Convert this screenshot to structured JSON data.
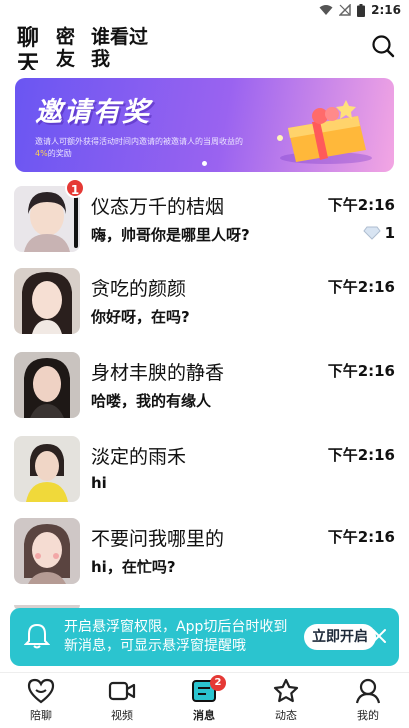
{
  "status_bar": {
    "time": "2:16",
    "icons": [
      "wifi-icon",
      "signal-off-icon",
      "battery-icon"
    ]
  },
  "header": {
    "tabs": [
      "聊天",
      "密友",
      "谁看过我"
    ],
    "search_icon": "search-icon"
  },
  "banner": {
    "title": "邀请有奖",
    "desc_part1": "邀请人可额外获得活动时间内邀请的被邀请人的当周收益的",
    "desc_highlight": "4%",
    "desc_part2": "的奖励",
    "highlight_color": "#ffd34d"
  },
  "conversations": [
    {
      "name": "仪态万千的桔烟",
      "message": "嗨，帅哥你是哪里人呀?",
      "time": "下午2:16",
      "unread": "1",
      "extra": "1",
      "extra_icon": "diamond-icon"
    },
    {
      "name": "贪吃的颜颜",
      "message": "你好呀，在吗?",
      "time": "下午2:16"
    },
    {
      "name": "身材丰腴的静香",
      "message": "哈喽，我的有缘人",
      "time": "下午2:16"
    },
    {
      "name": "淡定的雨禾",
      "message": "hi",
      "time": "下午2:16"
    },
    {
      "name": "不要问我哪里的",
      "message": "hi，在忙吗?",
      "time": "下午2:16"
    }
  ],
  "toast": {
    "text": "开启悬浮窗权限，App切后台时收到新消息，可显示悬浮窗提醒哦",
    "button": "立即开启",
    "color": "#2bc4cf"
  },
  "bottom_nav": [
    {
      "label": "陪聊",
      "icon": "heart-chat-icon"
    },
    {
      "label": "视频",
      "icon": "video-icon"
    },
    {
      "label": "消息",
      "icon": "message-icon",
      "badge": "2",
      "active": true
    },
    {
      "label": "动态",
      "icon": "star-icon"
    },
    {
      "label": "我的",
      "icon": "profile-icon"
    }
  ]
}
